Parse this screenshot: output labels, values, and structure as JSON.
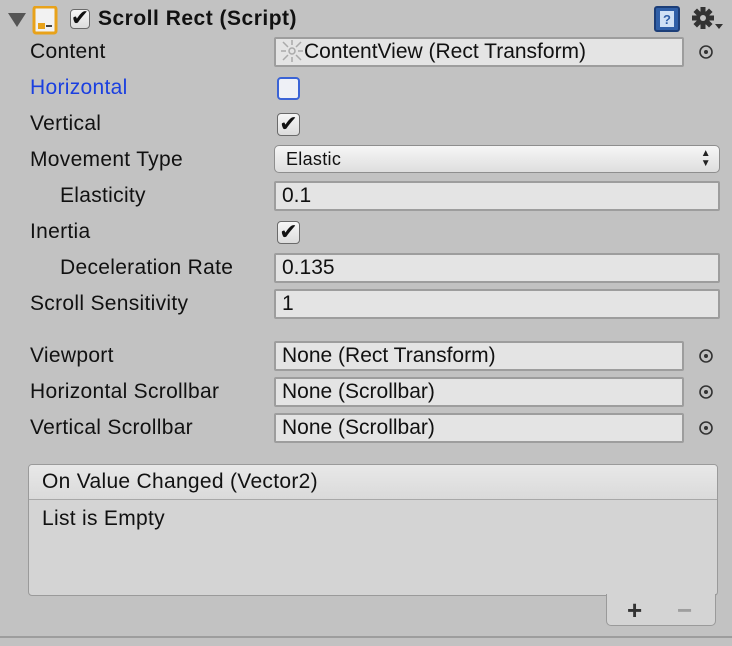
{
  "component": {
    "title": "Scroll Rect (Script)",
    "enabled": true
  },
  "fields": {
    "content": {
      "label": "Content",
      "value": "ContentView (Rect Transform)"
    },
    "horizontal": {
      "label": "Horizontal",
      "checked": false
    },
    "vertical": {
      "label": "Vertical",
      "checked": true,
      "mark": "✔"
    },
    "movement_type": {
      "label": "Movement Type",
      "value": "Elastic",
      "arrows": "▲\n▼"
    },
    "elasticity": {
      "label": "Elasticity",
      "value": "0.1"
    },
    "inertia": {
      "label": "Inertia",
      "checked": true,
      "mark": "✔"
    },
    "deceleration_rate": {
      "label": "Deceleration Rate",
      "value": "0.135"
    },
    "scroll_sensitivity": {
      "label": "Scroll Sensitivity",
      "value": "1"
    },
    "viewport": {
      "label": "Viewport",
      "value": "None (Rect Transform)"
    },
    "horizontal_scrollbar": {
      "label": "Horizontal Scrollbar",
      "value": "None (Scrollbar)"
    },
    "vertical_scrollbar": {
      "label": "Vertical Scrollbar",
      "value": "None (Scrollbar)"
    }
  },
  "event": {
    "title": "On Value Changed (Vector2)",
    "empty_text": "List is Empty",
    "add_label": "+",
    "remove_label": "−"
  },
  "icons": {
    "foldout": "triangle-down-icon",
    "script": "script-icon",
    "help": "help-book-icon",
    "settings": "gear-icon",
    "picker": "object-picker-icon",
    "rect_transform": "rect-transform-icon"
  },
  "colors": {
    "background": "#c2c2c2",
    "label_focus": "#1a3fe0",
    "field_bg": "#e4e4e4"
  }
}
